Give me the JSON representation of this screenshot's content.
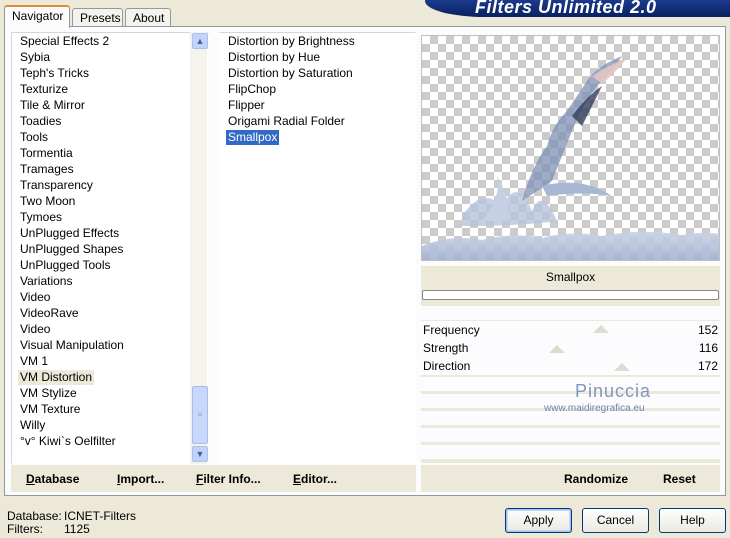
{
  "tabs": {
    "navigator": "Navigator",
    "presets": "Presets",
    "about": "About"
  },
  "banner_title": "Filters Unlimited 2.0",
  "categories": [
    "Special Effects 2",
    "Sybia",
    "Teph's Tricks",
    "Texturize",
    "Tile & Mirror",
    "Toadies",
    "Tools",
    "Tormentia",
    "Tramages",
    "Transparency",
    "Two Moon",
    "Tymoes",
    "UnPlugged Effects",
    "UnPlugged Shapes",
    "UnPlugged Tools",
    "Variations",
    "Video",
    "VideoRave",
    "Video",
    "Visual Manipulation",
    "VM 1",
    "VM Distortion",
    "VM Stylize",
    "VM Texture",
    "Willy",
    "°v° Kiwi`s Oelfilter"
  ],
  "selected_category": "VM Distortion",
  "filters": [
    "Distortion by Brightness",
    "Distortion by Hue",
    "Distortion by Saturation",
    "FlipChop",
    "Flipper",
    "Origami Radial Folder",
    "Smallpox"
  ],
  "selected_filter": "Smallpox",
  "filter_panel": {
    "name": "Smallpox",
    "params": [
      {
        "label": "Frequency",
        "value": "152"
      },
      {
        "label": "Strength",
        "value": "116"
      },
      {
        "label": "Direction",
        "value": "172"
      }
    ]
  },
  "watermark": {
    "name": "Pinuccia",
    "url": "www.maidiregrafica.eu"
  },
  "buttons": {
    "database": "Database",
    "import": "Import...",
    "filter_info": "Filter Info...",
    "editor": "Editor...",
    "randomize": "Randomize",
    "reset": "Reset",
    "apply": "Apply",
    "cancel": "Cancel",
    "help": "Help"
  },
  "status": {
    "database_label": "Database:",
    "database_value": "ICNET-Filters",
    "filters_label": "Filters:",
    "filters_value": "1125"
  },
  "icons": {
    "scroll_up": "chevron-up-icon",
    "scroll_down": "chevron-down-icon"
  }
}
